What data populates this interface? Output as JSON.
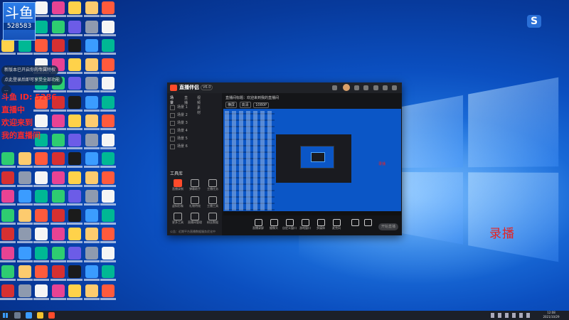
{
  "desktop": {
    "badge_logo": "斗鱼",
    "badge_number": "528583",
    "chip_1": "新版本已开启你的专属特权",
    "chip_2": "点此登录后即可享受全部功能",
    "chip_3": "...",
    "red_overlay_1": "斗鱼 ID: 5286",
    "red_overlay_2": "直播中",
    "red_overlay_3": "欢迎来到",
    "red_overlay_4": "我的直播间",
    "recording_label": "录播",
    "s_app_letter": "S"
  },
  "app": {
    "name": "直播伴侣",
    "version": "V6.0",
    "tabs": [
      {
        "label": "场景"
      },
      {
        "label": "直播"
      },
      {
        "label": "视频素材"
      }
    ],
    "scenes": [
      {
        "label": "场景 1"
      },
      {
        "label": "场景 2"
      },
      {
        "label": "场景 3"
      },
      {
        "label": "场景 4"
      },
      {
        "label": "场景 5"
      },
      {
        "label": "场景 6"
      }
    ],
    "tools_title": "工具库",
    "tools": [
      {
        "label": "直播录制"
      },
      {
        "label": "弹幕助手"
      },
      {
        "label": "主播任务"
      },
      {
        "label": "虚拟形象"
      },
      {
        "label": "礼物特效"
      },
      {
        "label": "主播工具"
      },
      {
        "label": "更多工具"
      },
      {
        "label": "直播间管理"
      },
      {
        "label": "粉丝数据"
      }
    ],
    "status_text": "公告：近期平台直播数据服务优化中",
    "header_text": "直播间标题：欢迎来到我的直播间",
    "header_tags": [
      {
        "label": "横屏"
      },
      {
        "label": "高清"
      },
      {
        "label": "1080P"
      }
    ],
    "preview_red_text": "录播",
    "controls": [
      {
        "label": "直播录屏"
      },
      {
        "label": "摄像头"
      },
      {
        "label": "自定义窗口"
      },
      {
        "label": "游戏窗口"
      },
      {
        "label": "多媒体"
      },
      {
        "label": "麦克风"
      }
    ],
    "live_button": "开始直播"
  },
  "taskbar": {
    "clock_time": "12:08",
    "clock_date": "2021/10/29"
  }
}
